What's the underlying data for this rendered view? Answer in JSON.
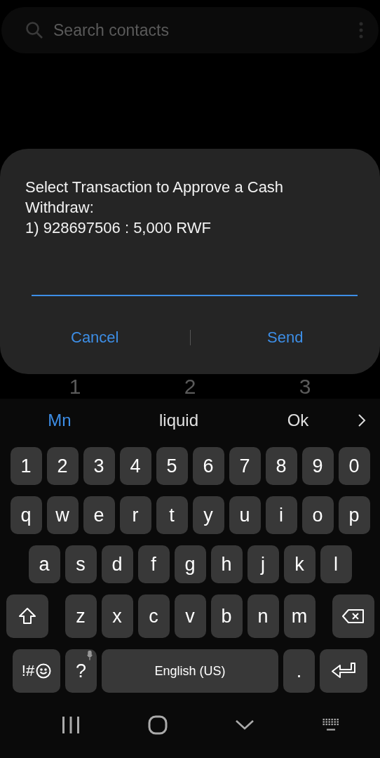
{
  "search": {
    "placeholder": "Search contacts"
  },
  "dialog": {
    "message": "Select Transaction to Approve a Cash Withdraw:\n1) 928697506 : 5,000 RWF",
    "buttons": [
      {
        "label": "Cancel"
      },
      {
        "label": "Send"
      }
    ]
  },
  "dialpad": {
    "keys": [
      "1",
      "2",
      "3"
    ]
  },
  "suggestions": [
    {
      "label": "Mn",
      "selected": true
    },
    {
      "label": "liquid",
      "selected": false
    },
    {
      "label": "Ok",
      "selected": false
    }
  ],
  "keyboard": {
    "rows": [
      {
        "keys": [
          {
            "kind": "char",
            "label": "1"
          },
          {
            "kind": "char",
            "label": "2"
          },
          {
            "kind": "char",
            "label": "3"
          },
          {
            "kind": "char",
            "label": "4"
          },
          {
            "kind": "char",
            "label": "5"
          },
          {
            "kind": "char",
            "label": "6"
          },
          {
            "kind": "char",
            "label": "7"
          },
          {
            "kind": "char",
            "label": "8"
          },
          {
            "kind": "char",
            "label": "9"
          },
          {
            "kind": "char",
            "label": "0"
          }
        ]
      },
      {
        "keys": [
          {
            "kind": "char",
            "label": "q"
          },
          {
            "kind": "char",
            "label": "w"
          },
          {
            "kind": "char",
            "label": "e"
          },
          {
            "kind": "char",
            "label": "r"
          },
          {
            "kind": "char",
            "label": "t"
          },
          {
            "kind": "char",
            "label": "y"
          },
          {
            "kind": "char",
            "label": "u"
          },
          {
            "kind": "char",
            "label": "i"
          },
          {
            "kind": "char",
            "label": "o"
          },
          {
            "kind": "char",
            "label": "p"
          }
        ]
      },
      {
        "keys": [
          {
            "kind": "char",
            "label": "a"
          },
          {
            "kind": "char",
            "label": "s"
          },
          {
            "kind": "char",
            "label": "d"
          },
          {
            "kind": "char",
            "label": "f"
          },
          {
            "kind": "char",
            "label": "g"
          },
          {
            "kind": "char",
            "label": "h"
          },
          {
            "kind": "char",
            "label": "j"
          },
          {
            "kind": "char",
            "label": "k"
          },
          {
            "kind": "char",
            "label": "l"
          }
        ]
      },
      {
        "keys": [
          {
            "kind": "shift"
          },
          {
            "kind": "char",
            "label": "z"
          },
          {
            "kind": "char",
            "label": "x"
          },
          {
            "kind": "char",
            "label": "c"
          },
          {
            "kind": "char",
            "label": "v"
          },
          {
            "kind": "char",
            "label": "b"
          },
          {
            "kind": "char",
            "label": "n"
          },
          {
            "kind": "char",
            "label": "m"
          },
          {
            "kind": "backspace"
          }
        ]
      },
      {
        "keys": [
          {
            "kind": "symbols",
            "label": "!#"
          },
          {
            "kind": "mic",
            "label": "?"
          },
          {
            "kind": "space",
            "label": "English (US)"
          },
          {
            "kind": "char",
            "label": "."
          },
          {
            "kind": "enter"
          }
        ]
      }
    ]
  }
}
